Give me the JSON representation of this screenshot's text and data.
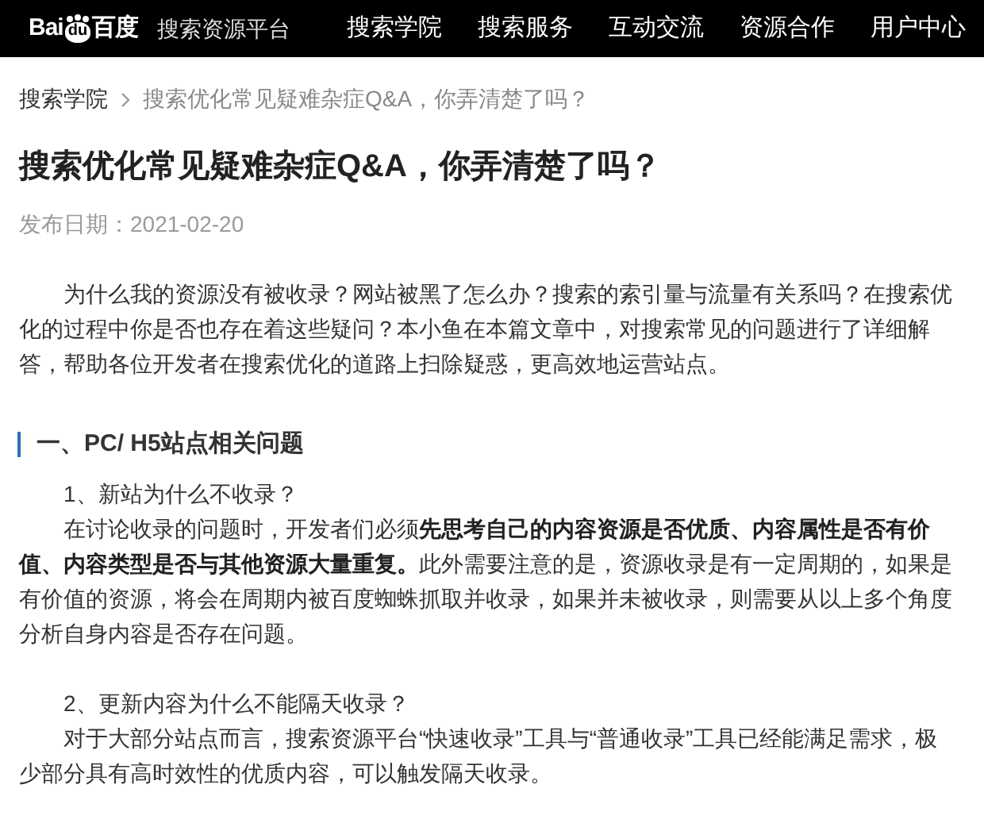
{
  "header": {
    "logo": {
      "prefix": "Bai",
      "paw": "du",
      "suffix": "百度"
    },
    "platform": "搜索资源平台",
    "nav": [
      {
        "label": "搜索学院"
      },
      {
        "label": "搜索服务"
      },
      {
        "label": "互动交流"
      },
      {
        "label": "资源合作"
      },
      {
        "label": "用户中心"
      }
    ]
  },
  "breadcrumb": [
    {
      "label": "搜索学院"
    },
    {
      "label": "搜索优化常见疑难杂症Q&A，你弄清楚了吗？"
    }
  ],
  "article": {
    "title": "搜索优化常见疑难杂症Q&A，你弄清楚了吗？",
    "date": "发布日期：2021-02-20",
    "blocks": [
      {
        "kind": "paragraph",
        "text": "为什么我的资源没有被收录？网站被黑了怎么办？搜索的索引量与流量有关系吗？在搜索优化的过程中你是否也存在着这些疑问？本小鱼在本篇文章中，对搜索常见的问题进行了详细解答，帮助各位开发者在搜索优化的道路上扫除疑惑，更高效地运营站点。"
      },
      {
        "kind": "heading",
        "text": "一、PC/ H5站点相关问题"
      },
      {
        "kind": "paragraph",
        "text": "1、新站为什么不收录？"
      },
      {
        "kind": "paragraph",
        "text": "在讨论收录的问题时，开发者们必须**先思考自己的内容资源是否优质、内容属性是否有价值、内容类型是否与其他资源大量重复。**此外需要注意的是，资源收录是有一定周期的，如果是有价值的资源，将会在周期内被百度蜘蛛抓取并收录，如果并未被收录，则需要从以上多个角度分析自身内容是否存在问题。"
      },
      {
        "kind": "spacer"
      },
      {
        "kind": "paragraph",
        "text": "2、更新内容为什么不能隔天收录？"
      },
      {
        "kind": "paragraph",
        "text": "对于大部分站点而言，搜索资源平台“快速收录”工具与“普通收录”工具已经能满足需求，极少部分具有高时效性的优质内容，可以触发隔天收录。"
      }
    ]
  }
}
